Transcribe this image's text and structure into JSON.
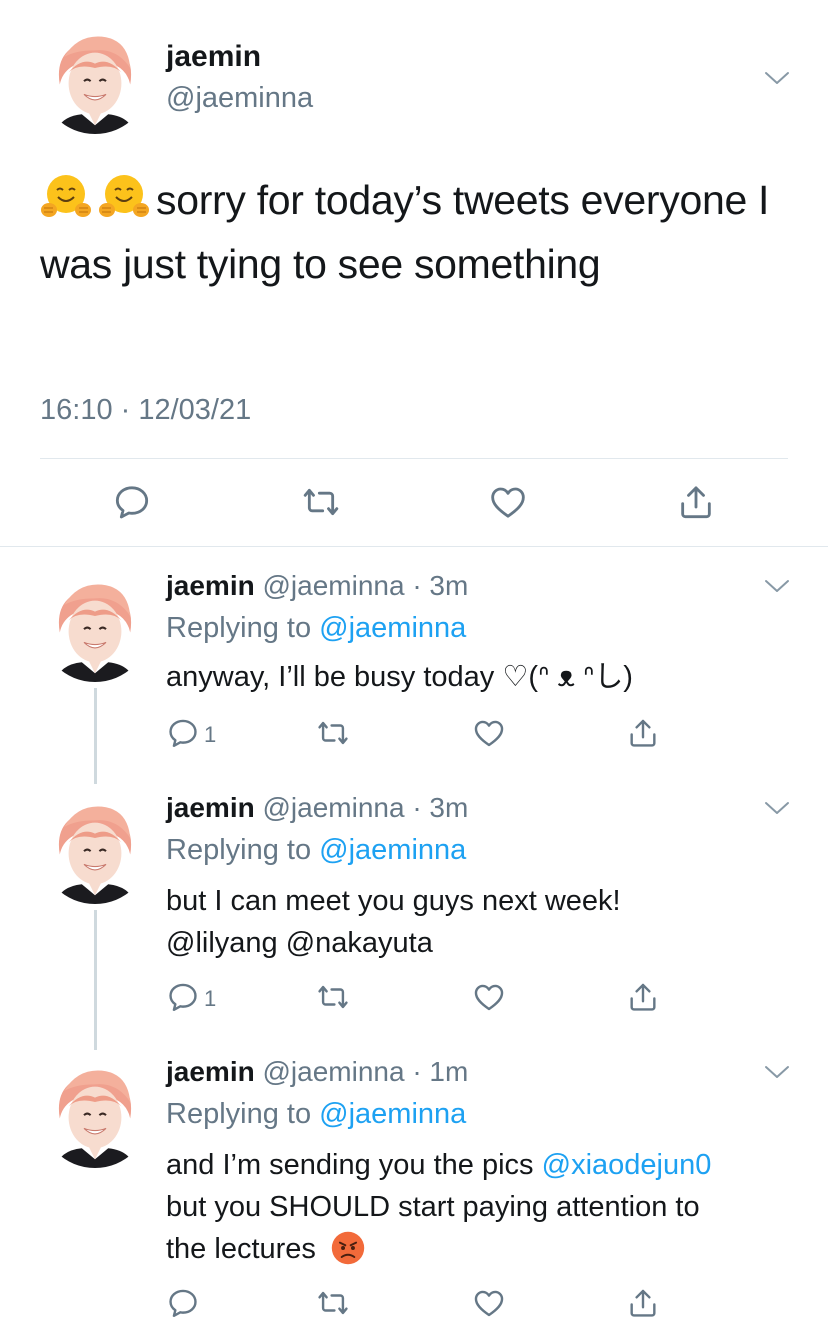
{
  "main_tweet": {
    "name": "jaemin",
    "handle": "@jaeminna",
    "text": "sorry for today’s tweets everyone I was just tying to see something",
    "emojis": [
      "hugging-face",
      "hugging-face"
    ],
    "timestamp": "16:10 · 12/03/21",
    "actions": [
      "reply",
      "retweet",
      "like",
      "share"
    ]
  },
  "replies": [
    {
      "name": "jaemin",
      "handle": "@jaeminna",
      "age": "· 3m",
      "replying_prefix": "Replying to",
      "replying_to": "@jaeminna",
      "text": "anyway, I’ll be busy today ♡(ᐢ ᴥ ᐢし)",
      "reply_count": "1"
    },
    {
      "name": "jaemin",
      "handle": "@jaeminna",
      "age": "· 3m",
      "replying_prefix": "Replying to",
      "replying_to": "@jaeminna",
      "text": "but I can meet you guys next week!",
      "mentions": "@lilyang @nakayuta",
      "reply_count": "1"
    },
    {
      "name": "jaemin",
      "handle": "@jaeminna",
      "age": "· 1m",
      "replying_prefix": "Replying to",
      "replying_to": "@jaeminna",
      "text_before": "and I’m sending you the pics",
      "mention": "@xiaodejun0",
      "text_line2": "but you SHOULD start paying attention to",
      "text_line3": "the lectures",
      "emoji": "angry-face",
      "reply_count": ""
    }
  ],
  "colors": {
    "text": "#14171a",
    "secondary": "#657786",
    "link": "#1da1f2",
    "divider": "#e1e8ed"
  }
}
